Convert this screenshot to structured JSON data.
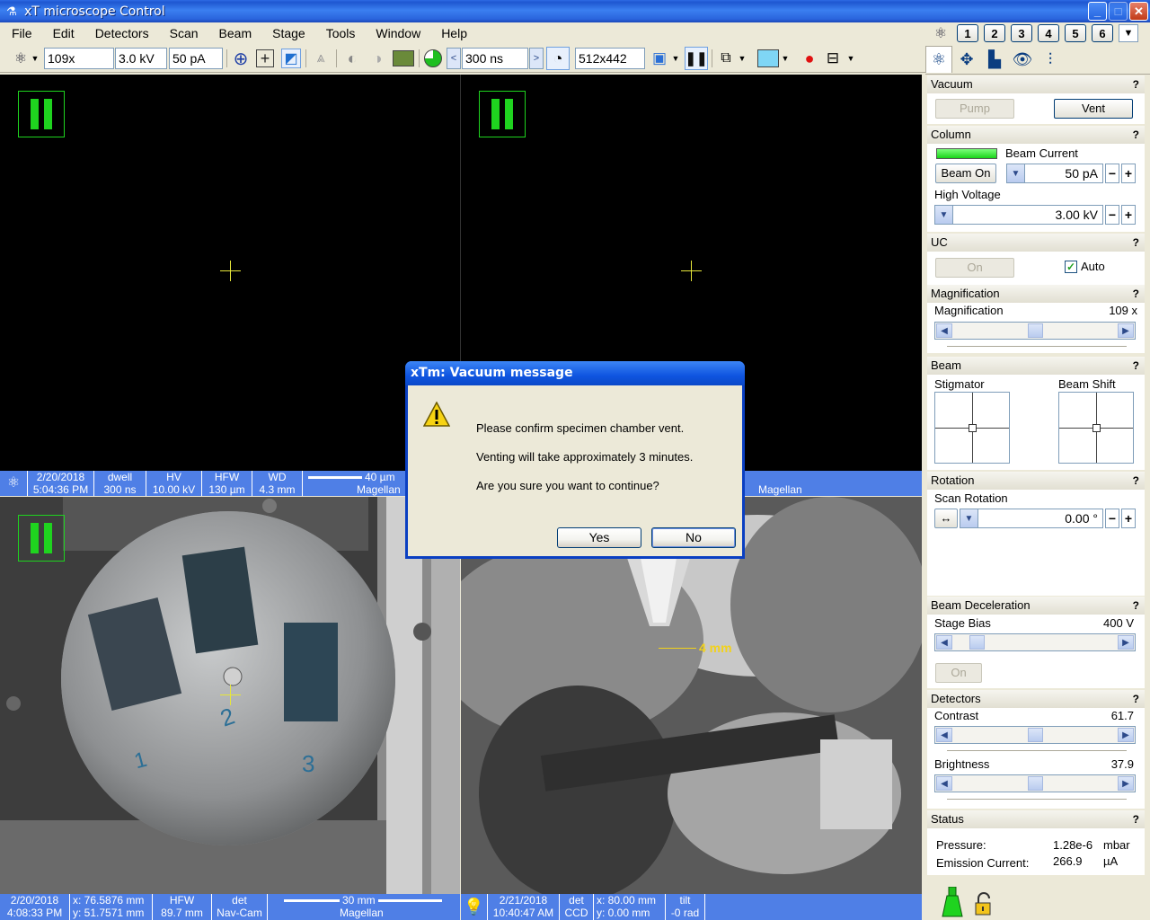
{
  "window": {
    "title": "xT microscope Control",
    "buttons": [
      "_",
      "□",
      "✕"
    ]
  },
  "menu": [
    "File",
    "Edit",
    "Detectors",
    "Scan",
    "Beam",
    "Stage",
    "Tools",
    "Window",
    "Help"
  ],
  "quad_buttons": [
    "1",
    "2",
    "3",
    "4",
    "5",
    "6"
  ],
  "toolbar": {
    "magnification": "109x",
    "high_voltage": "3.0 kV",
    "beam_current": "50 pA",
    "dwell": "300 ns",
    "resolution": "512x442"
  },
  "quad1_databar": {
    "date": "2/20/2018",
    "time": "5:04:36 PM",
    "dwell_label": "dwell",
    "dwell": "300 ns",
    "hv_label": "HV",
    "hv": "10.00 kV",
    "hfw_label": "HFW",
    "hfw": "130 µm",
    "wd_label": "WD",
    "wd": "4.3 mm",
    "scale": "40 µm",
    "brand": "Magellan"
  },
  "quad2_databar": {
    "brand": "Magellan"
  },
  "quad3_databar": {
    "date": "2/20/2018",
    "time": "4:08:33 PM",
    "x": "x: 76.5876 mm",
    "y": "y: 51.7571 mm",
    "hfw_label": "HFW",
    "hfw": "89.7 mm",
    "det_label": "det",
    "det": "Nav-Cam",
    "scale": "30 mm",
    "brand": "Magellan"
  },
  "quad4_databar": {
    "date": "2/21/2018",
    "time": "10:40:47 AM",
    "det_label": "det",
    "det": "CCD",
    "x": "x: 80.00 mm",
    "y": "y: 0.00 mm",
    "tilt_label": "tilt",
    "tilt": "-0 rad"
  },
  "ccd_scale": "4 mm",
  "navcam_numbers": [
    "1",
    "2",
    "3"
  ],
  "dialog": {
    "title": "xTm: Vacuum message",
    "line1": "Please confirm specimen chamber vent.",
    "line2": "Venting will take approximately 3 minutes.",
    "line3": "Are you sure you want to continue?",
    "yes": "Yes",
    "no": "No"
  },
  "panel": {
    "vacuum": {
      "title": "Vacuum",
      "pump": "Pump",
      "vent": "Vent"
    },
    "column": {
      "title": "Column",
      "beam_current_label": "Beam Current",
      "beam_on": "Beam On",
      "beam_current": "50 pA",
      "high_voltage_label": "High Voltage",
      "high_voltage": "3.00 kV"
    },
    "uc": {
      "title": "UC",
      "on": "On",
      "auto": "Auto",
      "auto_checked": true
    },
    "magnification": {
      "title": "Magnification",
      "label": "Magnification",
      "value": "109 x"
    },
    "beam": {
      "title": "Beam",
      "stigmator": "Stigmator",
      "beam_shift": "Beam Shift"
    },
    "rotation": {
      "title": "Rotation",
      "label": "Scan Rotation",
      "value": "0.00 °"
    },
    "beam_decel": {
      "title": "Beam Deceleration",
      "stage_bias_label": "Stage Bias",
      "stage_bias": "400 V",
      "on": "On"
    },
    "detectors": {
      "title": "Detectors",
      "contrast_label": "Contrast",
      "contrast": "61.7",
      "brightness_label": "Brightness",
      "brightness": "37.9"
    },
    "status": {
      "title": "Status",
      "pressure_label": "Pressure:",
      "pressure": "1.28e-6",
      "pressure_unit": "mbar",
      "emission_label": "Emission Current:",
      "emission": "266.9",
      "emission_unit": "µA"
    },
    "help": "?"
  },
  "colors": {
    "accent_green": "#1fd31f",
    "databar_blue": "#4f7fe6",
    "title_blue": "#2a64dd"
  }
}
